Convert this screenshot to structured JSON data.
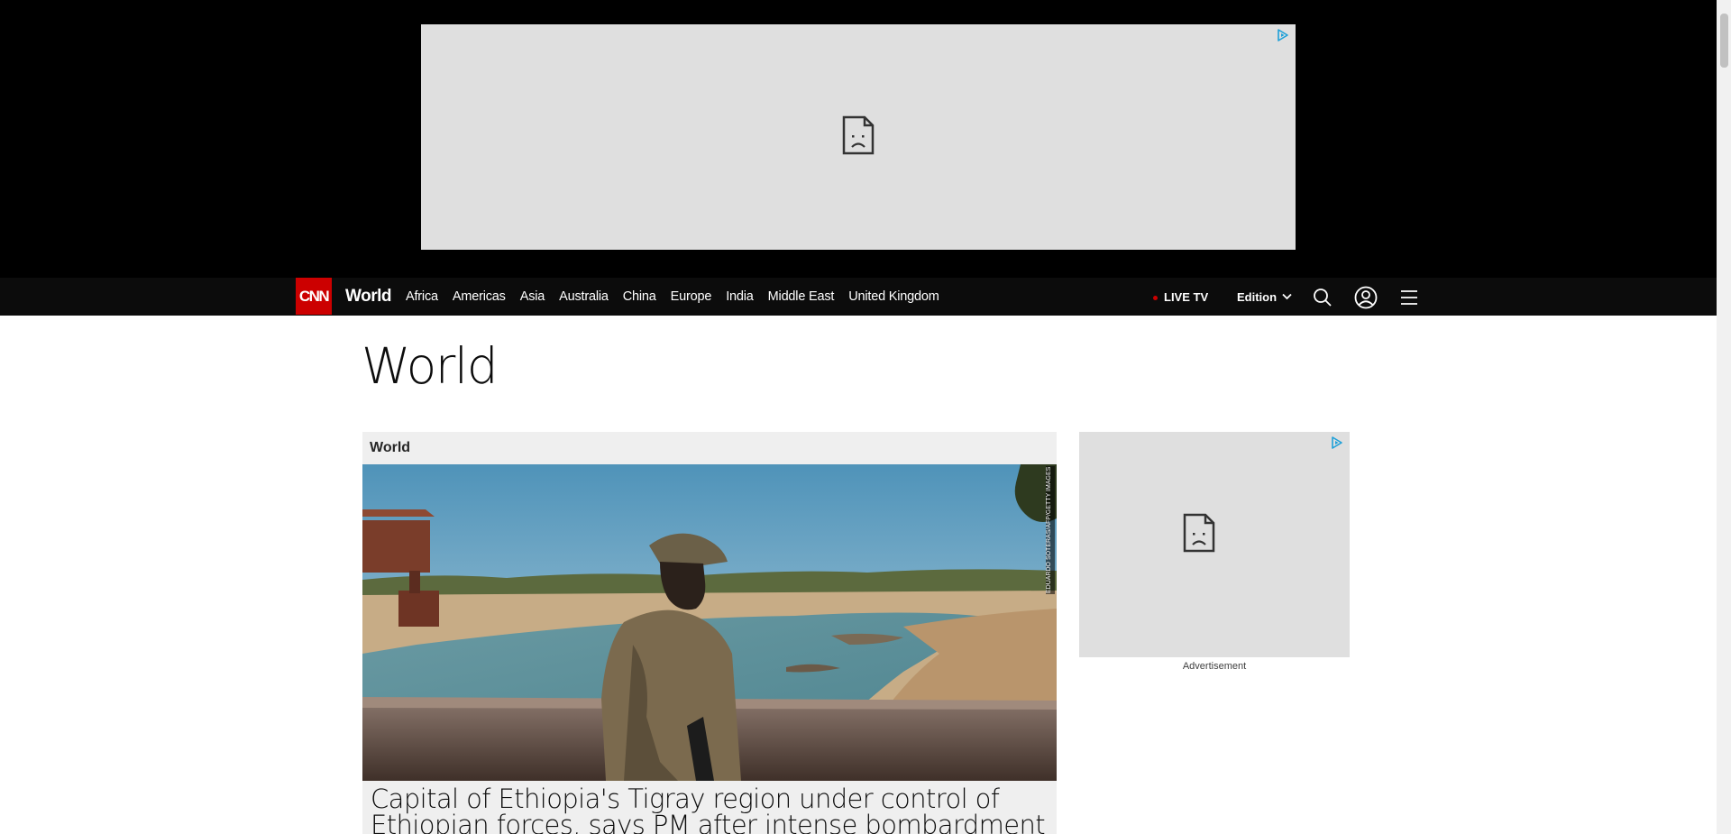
{
  "nav": {
    "logo": "CNN",
    "section": "World",
    "links": [
      "Africa",
      "Americas",
      "Asia",
      "Australia",
      "China",
      "Europe",
      "India",
      "Middle East",
      "United Kingdom"
    ],
    "live_tv": "LIVE TV",
    "edition": "Edition",
    "icons": [
      "search-icon",
      "account-icon",
      "menu-icon"
    ]
  },
  "main": {
    "title": "World",
    "card": {
      "label": "World",
      "photo_credit": "EDUARDO SOTERAS/AFP/GETTY IMAGES",
      "headline": "Capital of Ethiopia's Tigray region under control of Ethiopian forces, says PM after intense bombardment"
    },
    "side_ad_caption": "Advertisement"
  },
  "colors": {
    "brand_red": "#cc0000",
    "nav_bg": "#0c0c0c",
    "ad_bg": "#dfdfdf",
    "card_bg": "#efefef"
  }
}
